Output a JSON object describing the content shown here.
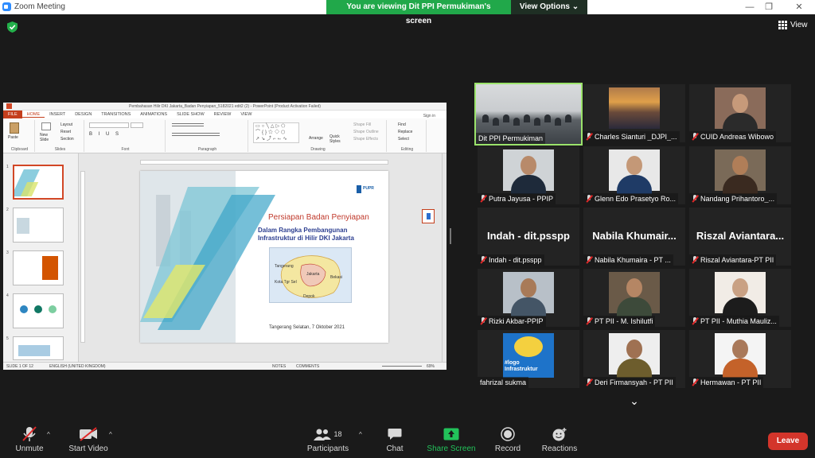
{
  "window": {
    "title": "Zoom Meeting"
  },
  "share_banner": {
    "message": "You are viewing Dit PPI Permukiman's screen",
    "options_label": "View Options"
  },
  "view_button": {
    "label": "View"
  },
  "powerpoint": {
    "title": "Pembahasan Hilir DKI Jakarta_Badan Penyiapan_5182021 edit2 (2) - PowerPoint (Product Activation Failed)",
    "sign_in": "Sign in",
    "tabs": [
      "FILE",
      "HOME",
      "INSERT",
      "DESIGN",
      "TRANSITIONS",
      "ANIMATIONS",
      "SLIDE SHOW",
      "REVIEW",
      "VIEW"
    ],
    "groups": [
      "Clipboard",
      "Slides",
      "Font",
      "Paragraph",
      "Drawing",
      "Editing"
    ],
    "ribbon_items": {
      "paste": "Paste",
      "new_slide": "New Slide",
      "layout": "Layout",
      "reset": "Reset",
      "section": "Section",
      "arrange": "Arrange",
      "quick_styles": "Quick Styles",
      "shape_fill": "Shape Fill",
      "shape_outline": "Shape Outline",
      "shape_effects": "Shape Effects",
      "find": "Find",
      "replace": "Replace",
      "select": "Select"
    },
    "thumb_numbers": [
      "1",
      "2",
      "3",
      "4",
      "5"
    ],
    "slide": {
      "heading": "Persiapan Badan Penyiapan",
      "subheading": "Dalam Rangka Pembangunan Infrastruktur di Hilir DKI Jakarta",
      "date_line": "Tangerang Selatan, 7 Oktober 2021",
      "logo_text": "PUPR",
      "map_labels": [
        "Tangerang",
        "Jakarta",
        "Bekasi",
        "Kota Tgr Sel",
        "Depok"
      ]
    },
    "status": {
      "slide_count": "SLIDE 1 OF 12",
      "language": "ENGLISH (UNITED KINGDOM)",
      "notes": "NOTES",
      "comments": "COMMENTS",
      "zoom": "69%"
    }
  },
  "participants_tiles": [
    {
      "name": "Dit PPI Permukiman",
      "muted": false,
      "active": true,
      "kind": "room"
    },
    {
      "name": "Charles Sianturi _DJPI_...",
      "muted": true,
      "kind": "sunset"
    },
    {
      "name": "CUID Andreas Wibowo",
      "muted": true,
      "kind": "face",
      "skin": "#c79a7a",
      "shirt": "#2b2b2b",
      "bg": "#8a6b5a"
    },
    {
      "name": "Putra Jayusa - PPIP",
      "muted": true,
      "kind": "face",
      "skin": "#b88a6a",
      "shirt": "#1e2a3a",
      "bg": "#cfd3d6"
    },
    {
      "name": "Glenn Edo Prasetyo Ro...",
      "muted": true,
      "kind": "face",
      "skin": "#c49877",
      "shirt": "#1f3b66",
      "bg": "#e8e8e8"
    },
    {
      "name": "Nandang Prihantoro_...",
      "muted": true,
      "kind": "face",
      "skin": "#b07e58",
      "shirt": "#3a2a20",
      "bg": "#7a6a58"
    },
    {
      "name": "Indah - dit.psspp",
      "muted": true,
      "kind": "text",
      "big": "Indah - dit.psspp"
    },
    {
      "name": "Nabila Khumaira - PT ...",
      "muted": true,
      "kind": "text",
      "big": "Nabila Khumair..."
    },
    {
      "name": "Riszal Aviantara-PT PII",
      "muted": true,
      "kind": "text",
      "big": "Riszal Aviantara..."
    },
    {
      "name": "Rizki Akbar-PPIP",
      "muted": true,
      "kind": "face",
      "skin": "#a87a58",
      "shirt": "#445566",
      "bg": "#b8c0c8"
    },
    {
      "name": "PT PII - M. Ishilutfi",
      "muted": true,
      "kind": "face",
      "skin": "#b58664",
      "shirt": "#3d4a3a",
      "bg": "#6a5a48"
    },
    {
      "name": "PT PII - Muthia Mauliz...",
      "muted": true,
      "kind": "face",
      "skin": "#c9a184",
      "shirt": "#1c1c1c",
      "bg": "#f1ece6"
    },
    {
      "name": "fahrizal sukma",
      "muted": false,
      "kind": "poster",
      "poster_text": "#logo Infrastruktur"
    },
    {
      "name": "Deri Firmansyah - PT PII",
      "muted": true,
      "kind": "face",
      "skin": "#9f7152",
      "shirt": "#6d5d2d",
      "bg": "#eeeeee"
    },
    {
      "name": "Hermawan - PT PII",
      "muted": true,
      "kind": "face",
      "skin": "#a9795a",
      "shirt": "#c4622a",
      "bg": "#f4f4f4"
    }
  ],
  "toolbar": {
    "unmute": "Unmute",
    "start_video": "Start Video",
    "participants": "Participants",
    "participants_count": "18",
    "chat": "Chat",
    "share_screen": "Share Screen",
    "record": "Record",
    "reactions": "Reactions",
    "leave": "Leave"
  },
  "colors": {
    "share_green": "#21a84a",
    "leave_red": "#d3352b",
    "active_outline": "#9be36b",
    "accent_red": "#c43e1c"
  }
}
